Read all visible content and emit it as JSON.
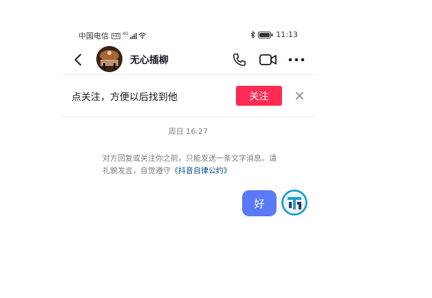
{
  "status_bar": {
    "carrier": "中国电信",
    "sim_badge": "HD",
    "network": "4G",
    "time": "11:13"
  },
  "header": {
    "contact_name": "无心插柳"
  },
  "follow_banner": {
    "text": "点关注，方便以后找到他",
    "follow_label": "关注"
  },
  "chat": {
    "timestamp": "周日 16:27",
    "notice_text": "对方回复或关注你之前，只能发送一条文字消息。请礼貌发言，自觉遵守",
    "notice_link": "《抖音自律公约》",
    "messages": [
      {
        "text": "好",
        "from": "me"
      }
    ]
  },
  "colors": {
    "accent_red": "#fe2c55",
    "bubble_blue": "#5b7af5",
    "link_blue": "#04498d"
  }
}
